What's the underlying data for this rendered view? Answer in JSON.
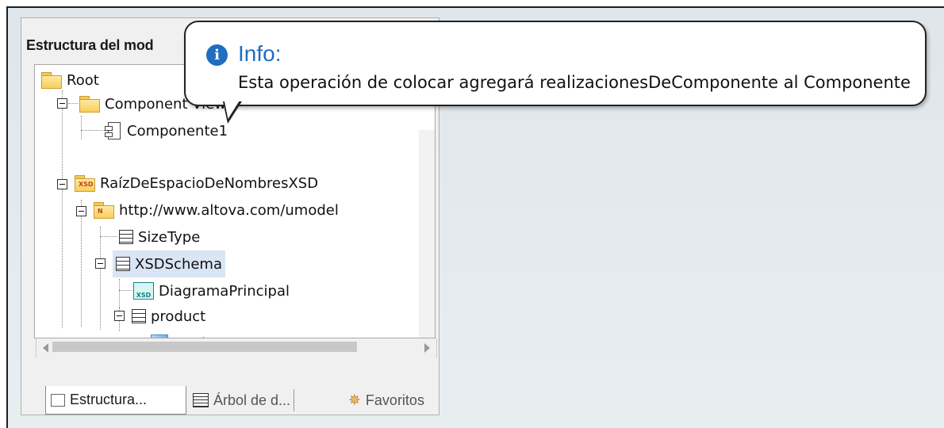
{
  "panel": {
    "title": "Estructura del mod",
    "tree": [
      {
        "label": "Root",
        "icon": "folder-icon"
      },
      {
        "label": "Component View",
        "icon": "folder-icon",
        "expanded": true
      },
      {
        "label": "Componente1",
        "icon": "component-icon"
      },
      {
        "label": "RaízDeEspacioDeNombresXSD",
        "icon": "xsd-folder-icon",
        "tag": "XSD",
        "expanded": true
      },
      {
        "label": "http://www.altova.com/umodel",
        "icon": "namespace-folder-icon",
        "tag": "N",
        "expanded": true
      },
      {
        "label": "SizeType",
        "icon": "class-icon"
      },
      {
        "label": "XSDSchema",
        "icon": "class-icon",
        "selected": true,
        "expanded": true
      },
      {
        "label": "DiagramaPrincipal",
        "icon": "xsd-diagram-icon",
        "tag": "XSD"
      },
      {
        "label": "product",
        "icon": "class-icon",
        "expanded": true
      },
      {
        "label": "product",
        "icon": "simple-type-icon"
      }
    ],
    "tabs": [
      {
        "label": "Estructura...",
        "icon": "folder-tab-icon",
        "active": true
      },
      {
        "label": "Árbol de d...",
        "icon": "diagram-tree-icon"
      },
      {
        "label": "Favoritos",
        "icon": "favorites-icon"
      }
    ]
  },
  "tooltip": {
    "icon": "info-icon",
    "icon_text": "i",
    "title": "Info:",
    "message": "Esta operación de colocar agregará realizacionesDeComponente al Componente"
  },
  "colors": {
    "info_blue": "#1f6ec1",
    "selection": "#d9e4f5",
    "folder": "#f7cf5c"
  }
}
